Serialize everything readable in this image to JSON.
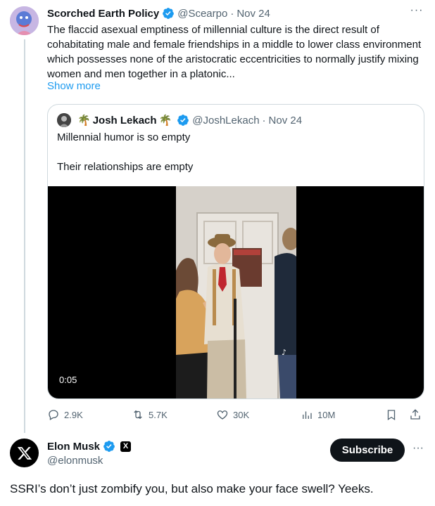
{
  "tweet1": {
    "display_name": "Scorched Earth Policy",
    "handle": "@Scearpo",
    "separator": "·",
    "date": "Nov 24",
    "text": "The flaccid asexual emptiness of millennial culture is the direct result of cohabitating male and female friendships in a middle to lower class environment which possesses none of the aristocratic eccentricities to normally justify mixing women and men together in a platonic...",
    "show_more": "Show more"
  },
  "quote": {
    "display_name": "Josh Lekach",
    "palm_emoji": "🌴",
    "handle": "@JoshLekach",
    "separator": "·",
    "date": "Nov 24",
    "line1": "Millennial humor is so empty",
    "line2": "Their relationships are empty",
    "video_duration": "0:05"
  },
  "actions": {
    "replies": "2.9K",
    "reposts": "5.7K",
    "likes": "30K",
    "views": "10M"
  },
  "tweet2": {
    "display_name": "Elon Musk",
    "badge": "X",
    "handle": "@elonmusk",
    "subscribe_label": "Subscribe",
    "text": "SSRI’s don’t just zombify you, but also make your face swell? Yeeks."
  },
  "icons": {
    "verified_color": "#1d9bf0",
    "accent": "#1d9bf0"
  }
}
